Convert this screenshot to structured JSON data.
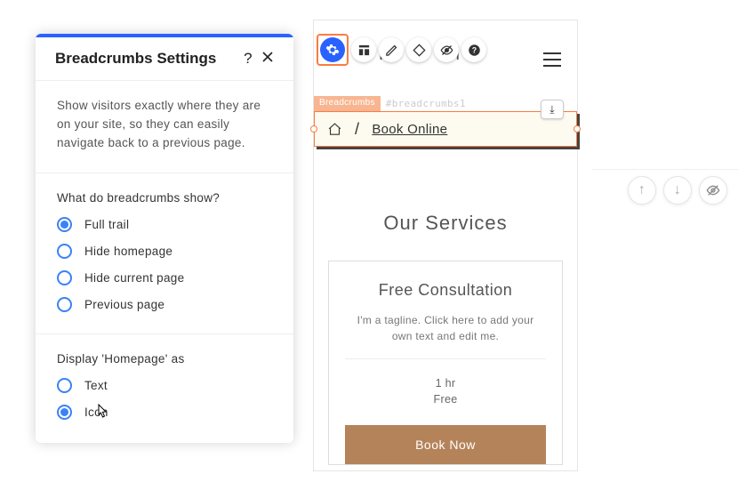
{
  "panel": {
    "title": "Breadcrumbs Settings",
    "help": "?",
    "description": "Show visitors exactly where they are on your site, so they can easily navigate back to a previous page.",
    "show_section_title": "What do breadcrumbs show?",
    "show_options": [
      {
        "label": "Full trail",
        "checked": true
      },
      {
        "label": "Hide homepage",
        "checked": false
      },
      {
        "label": "Hide current page",
        "checked": false
      },
      {
        "label": "Previous page",
        "checked": false
      }
    ],
    "display_section_title": "Display 'Homepage' as",
    "display_options": [
      {
        "label": "Text",
        "checked": false
      },
      {
        "label": "Icon",
        "checked": true
      }
    ]
  },
  "canvas": {
    "bg_title_fragments": {
      "a": "H",
      "b": "n",
      "c": "Cl"
    },
    "breadcrumb": {
      "badge": "Breadcrumbs",
      "id": "#breadcrumbs1",
      "link": "Book Online",
      "separator": "/"
    },
    "services_title": "Our Services",
    "service": {
      "title": "Free Consultation",
      "tagline": "I'm a tagline. Click here to add your own text and edit me.",
      "duration": "1 hr",
      "price": "Free",
      "button": "Book Now"
    }
  },
  "icons": {
    "arrow_up": "↑",
    "arrow_down": "↓",
    "download": "⤓"
  }
}
